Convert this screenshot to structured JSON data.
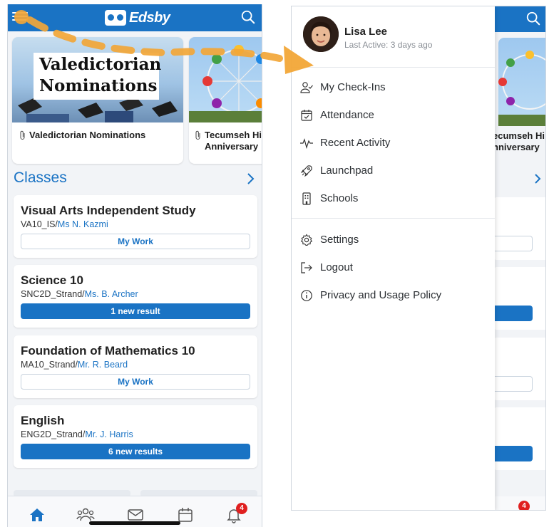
{
  "app": {
    "name": "Edsby"
  },
  "news": [
    {
      "image_text": [
        "Valedictorian",
        "Nominations"
      ],
      "caption": "Valedictorian Nominations"
    },
    {
      "caption_line1": "Tecumseh Hi",
      "caption_line2": "Anniversary"
    }
  ],
  "classes": {
    "header": "Classes",
    "items": [
      {
        "title": "Visual Arts Independent Study",
        "code": "VA10_IS",
        "teacher": "Ms N. Kazmi",
        "action": "My Work",
        "action_style": "outline"
      },
      {
        "title": "Science 10",
        "code": "SNC2D_Strand",
        "teacher": "Ms. B. Archer",
        "action": "1 new result",
        "action_style": "filled"
      },
      {
        "title": "Foundation of Mathematics 10",
        "code": "MA10_Strand",
        "teacher": "Mr. R. Beard",
        "action": "My Work",
        "action_style": "outline"
      },
      {
        "title": "English",
        "code": "ENG2D_Strand",
        "teacher": "Mr. J. Harris",
        "action": "6 new results",
        "action_style": "filled"
      }
    ]
  },
  "bottom_nav": {
    "items": [
      "home-icon",
      "people-icon",
      "mail-icon",
      "calendar-icon",
      "bell-icon"
    ],
    "notification_count": "4"
  },
  "background_peek": {
    "caption_line1": "ecumseh Hi",
    "caption_line2": "nniversary"
  },
  "drawer": {
    "user": {
      "name": "Lisa Lee",
      "last_active": "Last Active: 3 days ago"
    },
    "menu": [
      {
        "label": "My Check-Ins",
        "icon": "person-check-icon"
      },
      {
        "label": "Attendance",
        "icon": "calendar-check-icon"
      },
      {
        "label": "Recent Activity",
        "icon": "pulse-icon"
      },
      {
        "label": "Launchpad",
        "icon": "rocket-icon"
      },
      {
        "label": "Schools",
        "icon": "building-icon"
      }
    ],
    "menu2": [
      {
        "label": "Settings",
        "icon": "gear-icon"
      },
      {
        "label": "Logout",
        "icon": "logout-icon"
      },
      {
        "label": "Privacy and Usage Policy",
        "icon": "info-icon"
      }
    ]
  },
  "colors": {
    "brand": "#1a73c4",
    "badge": "#e02020",
    "arrow": "#f2a637"
  }
}
